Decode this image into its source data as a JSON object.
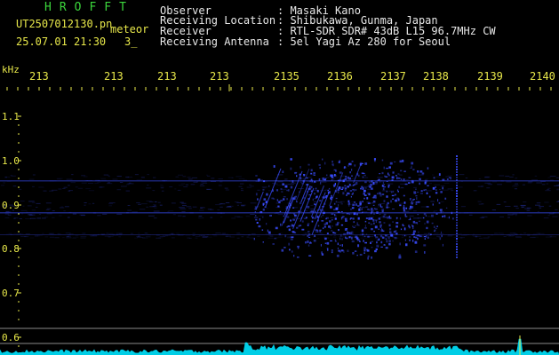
{
  "header": {
    "program": "HROFFT",
    "filename": "UT2507012130.pn",
    "mode_label": "meteor",
    "datetime": "25.07.01 21:30",
    "count": "3_",
    "info_labels": [
      "Observer",
      "Receiving Location",
      "Receiver",
      "Receiving Antenna"
    ],
    "info_values": [
      ": Masaki Kano",
      ": Shibukawa, Gunma, Japan",
      ": RTL-SDR SDR# 43dB L15 96.7MHz CW",
      ": 5el Yagi Az 280 for Seoul"
    ]
  },
  "chart_data": {
    "type": "heatmap",
    "ylabel": "kHz",
    "y_ticks": [
      "1.1",
      "1.0",
      "0.9",
      "0.8",
      "0.7",
      "0.6"
    ],
    "x_ticks": [
      "213",
      "213",
      "213",
      "213",
      "2135",
      "2136",
      "2137",
      "2138",
      "2139",
      "2140"
    ],
    "colors": {
      "background": "#000000",
      "signal": "#3a4dff",
      "spectrum": "#00e5ff",
      "axis": "#e8e84a",
      "grid": "#8a8a8a"
    }
  }
}
